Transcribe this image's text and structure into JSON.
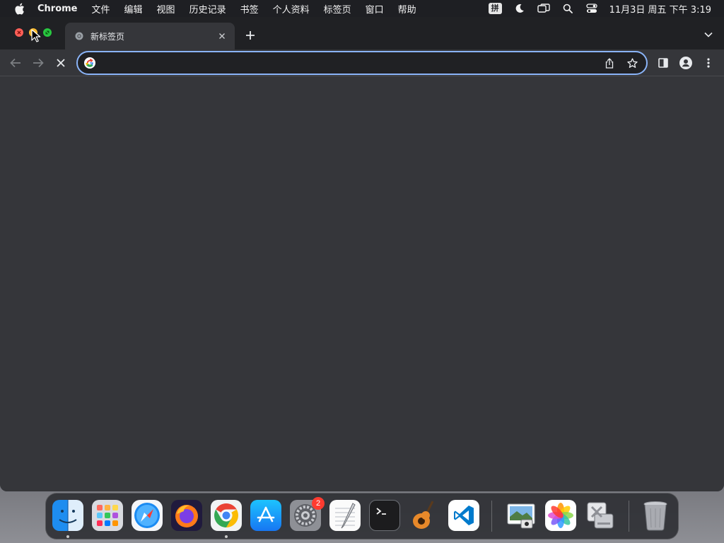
{
  "menubar": {
    "app_name": "Chrome",
    "items": [
      "文件",
      "编辑",
      "视图",
      "历史记录",
      "书签",
      "个人资料",
      "标签页",
      "窗口",
      "帮助"
    ],
    "ime_label": "拼",
    "datetime": "11月3日 周五 下午 3:19"
  },
  "tab": {
    "title": "新标签页",
    "favicon": "chrome-icon"
  },
  "omnibox": {
    "value": "",
    "placeholder": ""
  },
  "colors": {
    "window_bg": "#35363a",
    "tabstrip_bg": "#202124",
    "omnibox_border": "#8ab4f8",
    "close": "#ff5f57",
    "minimize": "#febc2e",
    "zoom": "#28c840"
  },
  "dock": {
    "apps": [
      {
        "name": "finder-icon",
        "running": true
      },
      {
        "name": "launchpad-icon",
        "running": false
      },
      {
        "name": "safari-icon",
        "running": false
      },
      {
        "name": "firefox-icon",
        "running": false
      },
      {
        "name": "chrome-icon",
        "running": true
      },
      {
        "name": "app-store-icon",
        "running": false
      },
      {
        "name": "system-settings-icon",
        "running": false,
        "badge": "2"
      },
      {
        "name": "textedit-icon",
        "running": false
      },
      {
        "name": "terminal-icon",
        "running": false
      },
      {
        "name": "garageband-icon",
        "running": false
      },
      {
        "name": "vscode-icon",
        "running": false
      },
      {
        "name": "preview-icon",
        "running": false
      },
      {
        "name": "photos-icon",
        "running": false
      },
      {
        "name": "disk-utility-icon",
        "running": false
      },
      {
        "name": "trash-icon",
        "running": false
      }
    ]
  }
}
